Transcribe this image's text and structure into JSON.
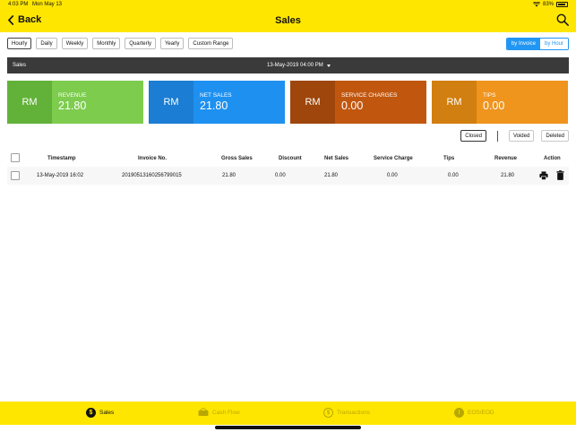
{
  "status_bar": {
    "time": "4:03 PM",
    "date": "Mon May 13",
    "battery": "83%"
  },
  "header": {
    "back_label": "Back",
    "title": "Sales"
  },
  "filters": [
    "Hourly",
    "Daily",
    "Weekly",
    "Monthly",
    "Quarterly",
    "Yearly",
    "Custom Range"
  ],
  "active_filter": "Hourly",
  "view_toggle": {
    "by_invoice": "by Invoice",
    "by_hour": "by Hour",
    "active": "by Invoice"
  },
  "dark_bar": {
    "label": "Sales",
    "date": "13-May-2019 04:00 PM"
  },
  "cards": [
    {
      "currency": "RM",
      "title": "REVENUE",
      "value": "21.80",
      "color_main": "#7dcc4e",
      "color_dark": "#62b23a"
    },
    {
      "currency": "RM",
      "title": "NET SALES",
      "value": "21.80",
      "color_main": "#1e90f0",
      "color_dark": "#1b7dd3"
    },
    {
      "currency": "RM",
      "title": "SERVICE CHARGES",
      "value": "0.00",
      "color_main": "#c1570f",
      "color_dark": "#9e460b"
    },
    {
      "currency": "RM",
      "title": "TIPS",
      "value": "0.00",
      "color_main": "#ef941d",
      "color_dark": "#d17f10"
    }
  ],
  "status_buttons": {
    "closed": "Closed",
    "voided": "Voided",
    "deleted": "Deleted"
  },
  "table": {
    "headers": {
      "timestamp": "Timestamp",
      "invoice": "Invoice No.",
      "gross": "Gross Sales",
      "discount": "Discount",
      "net": "Net Sales",
      "service": "Service Charge",
      "tips": "Tips",
      "revenue": "Revenue",
      "action": "Action"
    },
    "rows": [
      {
        "timestamp": "13-May-2019   16:02",
        "invoice": "20190513160256799015",
        "gross": "21.80",
        "discount": "0.00",
        "net": "21.80",
        "service": "0.00",
        "tips": "0.00",
        "revenue": "21.80"
      }
    ]
  },
  "bottom_nav": {
    "sales": "Sales",
    "cash_flow": "Cash Flow",
    "transactions": "Transactions",
    "eos": "EOS/EOD",
    "active_color": "#111111",
    "inactive_color": "#b8a800"
  }
}
